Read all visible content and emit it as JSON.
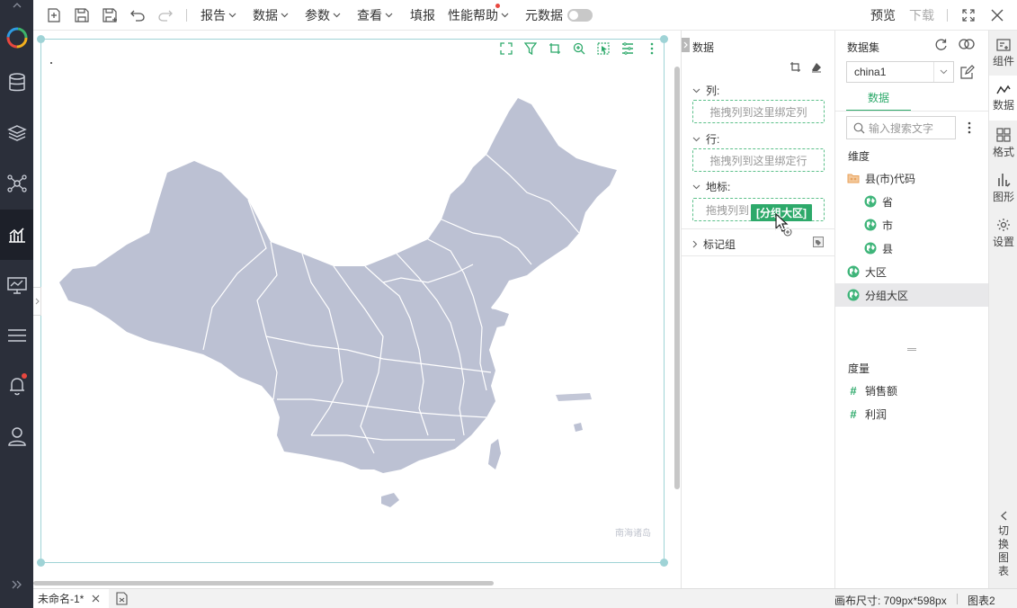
{
  "toolbar": {
    "menus": [
      {
        "label": "报告",
        "has_caret": true
      },
      {
        "label": "数据",
        "has_caret": true
      },
      {
        "label": "参数",
        "has_caret": true
      },
      {
        "label": "查看",
        "has_caret": true
      },
      {
        "label": "填报",
        "has_caret": false
      },
      {
        "label": "性能帮助",
        "has_caret": true
      },
      {
        "label": "元数据",
        "has_caret": false
      }
    ],
    "preview": "预览",
    "download": "下载"
  },
  "canvas": {
    "map_watermark": "南海诸岛",
    "map_fill": "#bcc1d3"
  },
  "config": {
    "title": "数据",
    "columns_label": "列:",
    "columns_placeholder": "拖拽列到这里绑定列",
    "rows_label": "行:",
    "rows_placeholder": "拖拽列到这里绑定行",
    "geo_label": "地标:",
    "geo_placeholder": "拖拽列到这里绑定地标",
    "geo_placeholder_visible": "拖拽列到",
    "dragging_field": "[分组大区]",
    "marker_group": "标记组"
  },
  "dataset": {
    "title": "数据集",
    "selected": "china1",
    "tab": "数据",
    "search_placeholder": "输入搜索文字",
    "dimension_header": "维度",
    "dimensions": [
      {
        "label": "县(市)代码",
        "icon": "folder-icon",
        "indent": false,
        "selected": false
      },
      {
        "label": "省",
        "icon": "globe-icon",
        "indent": true,
        "selected": false
      },
      {
        "label": "市",
        "icon": "globe-icon",
        "indent": true,
        "selected": false
      },
      {
        "label": "县",
        "icon": "globe-icon",
        "indent": true,
        "selected": false
      },
      {
        "label": "大区",
        "icon": "globe-icon",
        "indent": false,
        "selected": false
      },
      {
        "label": "分组大区",
        "icon": "globe-icon",
        "indent": false,
        "selected": true
      }
    ],
    "measure_header": "度量",
    "measures": [
      {
        "label": "销售额",
        "icon": "hash-icon"
      },
      {
        "label": "利润",
        "icon": "hash-icon"
      }
    ]
  },
  "right_strip": {
    "items": [
      "组件",
      "数据",
      "格式",
      "图形",
      "设置"
    ],
    "switch_chart": [
      "切",
      "换",
      "图",
      "表"
    ]
  },
  "status": {
    "doc_tab": "未命名-1*",
    "canvas_size": "画布尺寸: 709px*598px",
    "chart_name": "图表2"
  },
  "colors": {
    "accent": "#2da96a",
    "rail": "#2b2f3a",
    "frame": "#9fd3d6"
  }
}
